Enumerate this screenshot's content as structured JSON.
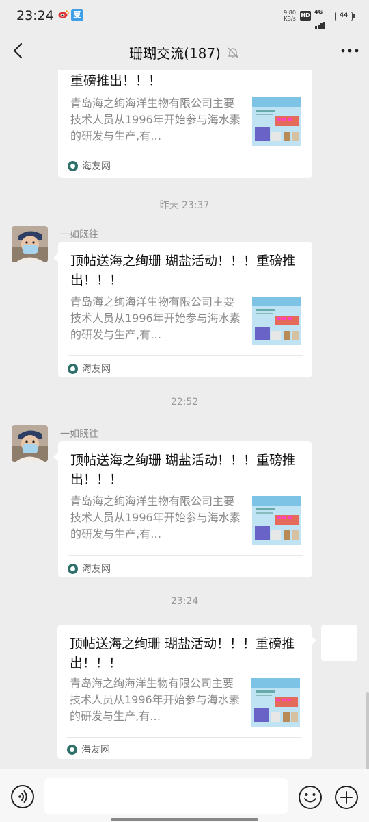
{
  "status_bar": {
    "time": "23:24",
    "speed_value": "9.80",
    "speed_unit": "KB/s",
    "hd": "HD",
    "network": "4G+",
    "battery": "44",
    "app_icon_letter": "夏"
  },
  "nav": {
    "title": "珊瑚交流(187)",
    "back_icon": "back-arrow-icon",
    "mute_icon": "bell-off-icon",
    "more_icon": "more-dots-icon"
  },
  "messages": {
    "partial": {
      "title_tail": "重磅推出！！！",
      "desc": "青岛海之绚海洋生物有限公司主要技术人员从1996年开始参与海水素的研发与生产,有…",
      "source": "海友网"
    },
    "ts1": "昨天 23:37",
    "msg1": {
      "sender": "一如既往",
      "title": "顶帖送海之绚珊 瑚盐活动！！！重磅推出！！！",
      "desc": "青岛海之绚海洋生物有限公司主要技术人员从1996年开始参与海水素的研发与生产,有…",
      "source": "海友网"
    },
    "ts2": "22:52",
    "msg2": {
      "sender": "一如既往",
      "title": "顶帖送海之绚珊 瑚盐活动！！！重磅推出！！！",
      "desc": "青岛海之绚海洋生物有限公司主要技术人员从1996年开始参与海水素的研发与生产,有…",
      "source": "海友网"
    },
    "ts3": "23:24",
    "msg3": {
      "title": "顶帖送海之绚珊 瑚盐活动！！！重磅推出！！！",
      "desc": "青岛海之绚海洋生物有限公司主要技术人员从1996年开始参与海水素的研发与生产,有…",
      "source": "海友网"
    }
  },
  "input_bar": {
    "voice_icon": "voice-icon",
    "emoji_icon": "emoji-icon",
    "plus_icon": "plus-icon",
    "text_value": ""
  }
}
